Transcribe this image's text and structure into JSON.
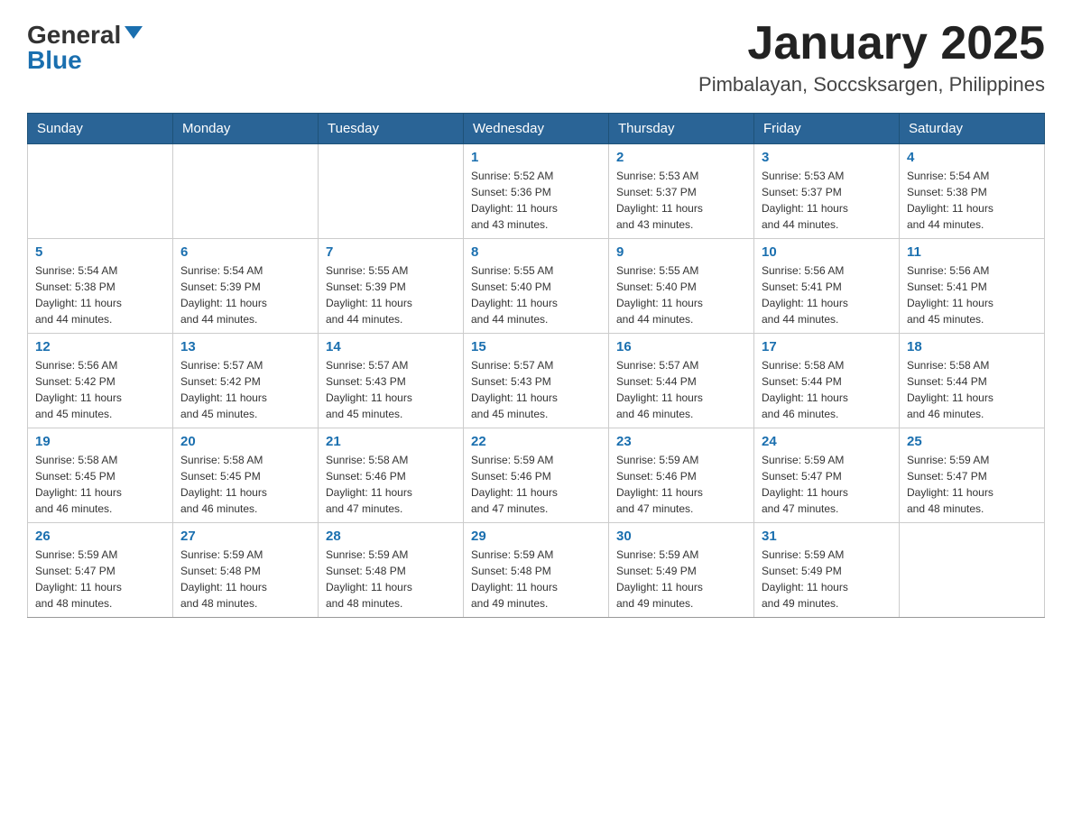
{
  "header": {
    "logo_general": "General",
    "logo_blue": "Blue",
    "month_title": "January 2025",
    "location": "Pimbalayan, Soccsksargen, Philippines"
  },
  "weekdays": [
    "Sunday",
    "Monday",
    "Tuesday",
    "Wednesday",
    "Thursday",
    "Friday",
    "Saturday"
  ],
  "weeks": [
    [
      {
        "day": "",
        "info": ""
      },
      {
        "day": "",
        "info": ""
      },
      {
        "day": "",
        "info": ""
      },
      {
        "day": "1",
        "info": "Sunrise: 5:52 AM\nSunset: 5:36 PM\nDaylight: 11 hours\nand 43 minutes."
      },
      {
        "day": "2",
        "info": "Sunrise: 5:53 AM\nSunset: 5:37 PM\nDaylight: 11 hours\nand 43 minutes."
      },
      {
        "day": "3",
        "info": "Sunrise: 5:53 AM\nSunset: 5:37 PM\nDaylight: 11 hours\nand 44 minutes."
      },
      {
        "day": "4",
        "info": "Sunrise: 5:54 AM\nSunset: 5:38 PM\nDaylight: 11 hours\nand 44 minutes."
      }
    ],
    [
      {
        "day": "5",
        "info": "Sunrise: 5:54 AM\nSunset: 5:38 PM\nDaylight: 11 hours\nand 44 minutes."
      },
      {
        "day": "6",
        "info": "Sunrise: 5:54 AM\nSunset: 5:39 PM\nDaylight: 11 hours\nand 44 minutes."
      },
      {
        "day": "7",
        "info": "Sunrise: 5:55 AM\nSunset: 5:39 PM\nDaylight: 11 hours\nand 44 minutes."
      },
      {
        "day": "8",
        "info": "Sunrise: 5:55 AM\nSunset: 5:40 PM\nDaylight: 11 hours\nand 44 minutes."
      },
      {
        "day": "9",
        "info": "Sunrise: 5:55 AM\nSunset: 5:40 PM\nDaylight: 11 hours\nand 44 minutes."
      },
      {
        "day": "10",
        "info": "Sunrise: 5:56 AM\nSunset: 5:41 PM\nDaylight: 11 hours\nand 44 minutes."
      },
      {
        "day": "11",
        "info": "Sunrise: 5:56 AM\nSunset: 5:41 PM\nDaylight: 11 hours\nand 45 minutes."
      }
    ],
    [
      {
        "day": "12",
        "info": "Sunrise: 5:56 AM\nSunset: 5:42 PM\nDaylight: 11 hours\nand 45 minutes."
      },
      {
        "day": "13",
        "info": "Sunrise: 5:57 AM\nSunset: 5:42 PM\nDaylight: 11 hours\nand 45 minutes."
      },
      {
        "day": "14",
        "info": "Sunrise: 5:57 AM\nSunset: 5:43 PM\nDaylight: 11 hours\nand 45 minutes."
      },
      {
        "day": "15",
        "info": "Sunrise: 5:57 AM\nSunset: 5:43 PM\nDaylight: 11 hours\nand 45 minutes."
      },
      {
        "day": "16",
        "info": "Sunrise: 5:57 AM\nSunset: 5:44 PM\nDaylight: 11 hours\nand 46 minutes."
      },
      {
        "day": "17",
        "info": "Sunrise: 5:58 AM\nSunset: 5:44 PM\nDaylight: 11 hours\nand 46 minutes."
      },
      {
        "day": "18",
        "info": "Sunrise: 5:58 AM\nSunset: 5:44 PM\nDaylight: 11 hours\nand 46 minutes."
      }
    ],
    [
      {
        "day": "19",
        "info": "Sunrise: 5:58 AM\nSunset: 5:45 PM\nDaylight: 11 hours\nand 46 minutes."
      },
      {
        "day": "20",
        "info": "Sunrise: 5:58 AM\nSunset: 5:45 PM\nDaylight: 11 hours\nand 46 minutes."
      },
      {
        "day": "21",
        "info": "Sunrise: 5:58 AM\nSunset: 5:46 PM\nDaylight: 11 hours\nand 47 minutes."
      },
      {
        "day": "22",
        "info": "Sunrise: 5:59 AM\nSunset: 5:46 PM\nDaylight: 11 hours\nand 47 minutes."
      },
      {
        "day": "23",
        "info": "Sunrise: 5:59 AM\nSunset: 5:46 PM\nDaylight: 11 hours\nand 47 minutes."
      },
      {
        "day": "24",
        "info": "Sunrise: 5:59 AM\nSunset: 5:47 PM\nDaylight: 11 hours\nand 47 minutes."
      },
      {
        "day": "25",
        "info": "Sunrise: 5:59 AM\nSunset: 5:47 PM\nDaylight: 11 hours\nand 48 minutes."
      }
    ],
    [
      {
        "day": "26",
        "info": "Sunrise: 5:59 AM\nSunset: 5:47 PM\nDaylight: 11 hours\nand 48 minutes."
      },
      {
        "day": "27",
        "info": "Sunrise: 5:59 AM\nSunset: 5:48 PM\nDaylight: 11 hours\nand 48 minutes."
      },
      {
        "day": "28",
        "info": "Sunrise: 5:59 AM\nSunset: 5:48 PM\nDaylight: 11 hours\nand 48 minutes."
      },
      {
        "day": "29",
        "info": "Sunrise: 5:59 AM\nSunset: 5:48 PM\nDaylight: 11 hours\nand 49 minutes."
      },
      {
        "day": "30",
        "info": "Sunrise: 5:59 AM\nSunset: 5:49 PM\nDaylight: 11 hours\nand 49 minutes."
      },
      {
        "day": "31",
        "info": "Sunrise: 5:59 AM\nSunset: 5:49 PM\nDaylight: 11 hours\nand 49 minutes."
      },
      {
        "day": "",
        "info": ""
      }
    ]
  ]
}
